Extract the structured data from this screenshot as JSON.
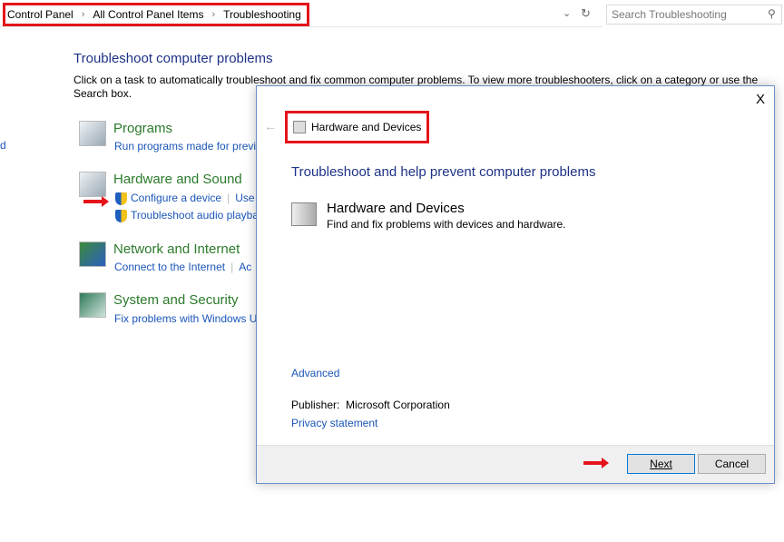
{
  "address_bar": {
    "breadcrumbs": [
      "Control Panel",
      "All Control Panel Items",
      "Troubleshooting"
    ],
    "dropdown_icon": "chevron-down-icon",
    "refresh_icon": "refresh-icon"
  },
  "search": {
    "placeholder": "Search Troubleshooting",
    "icon": "search-icon"
  },
  "sidebar_fragment": "d",
  "main": {
    "title": "Troubleshoot computer problems",
    "description": "Click on a task to automatically troubleshoot and fix common computer problems. To view more troubleshooters, click on a category or use the Search box.",
    "categories": [
      {
        "title": "Programs",
        "links": [
          "Run programs made for previ"
        ]
      },
      {
        "title": "Hardware and Sound",
        "links": [
          "Configure a device",
          "Use",
          "Troubleshoot audio playba"
        ]
      },
      {
        "title": "Network and Internet",
        "links": [
          "Connect to the Internet",
          "Ac"
        ]
      },
      {
        "title": "System and Security",
        "links": [
          "Fix problems with Windows U"
        ]
      }
    ]
  },
  "dialog": {
    "close": "X",
    "header_title": "Hardware and Devices",
    "heading": "Troubleshoot and help prevent computer problems",
    "item_title": "Hardware and Devices",
    "item_desc": "Find and fix problems with devices and hardware.",
    "advanced": "Advanced",
    "publisher_label": "Publisher:",
    "publisher": "Microsoft Corporation",
    "privacy": "Privacy statement",
    "next": "Next",
    "cancel": "Cancel"
  },
  "colors": {
    "highlight": "#e5141b",
    "link": "#1a56b8",
    "heading": "#1e3287",
    "category": "#2b7a2b"
  }
}
